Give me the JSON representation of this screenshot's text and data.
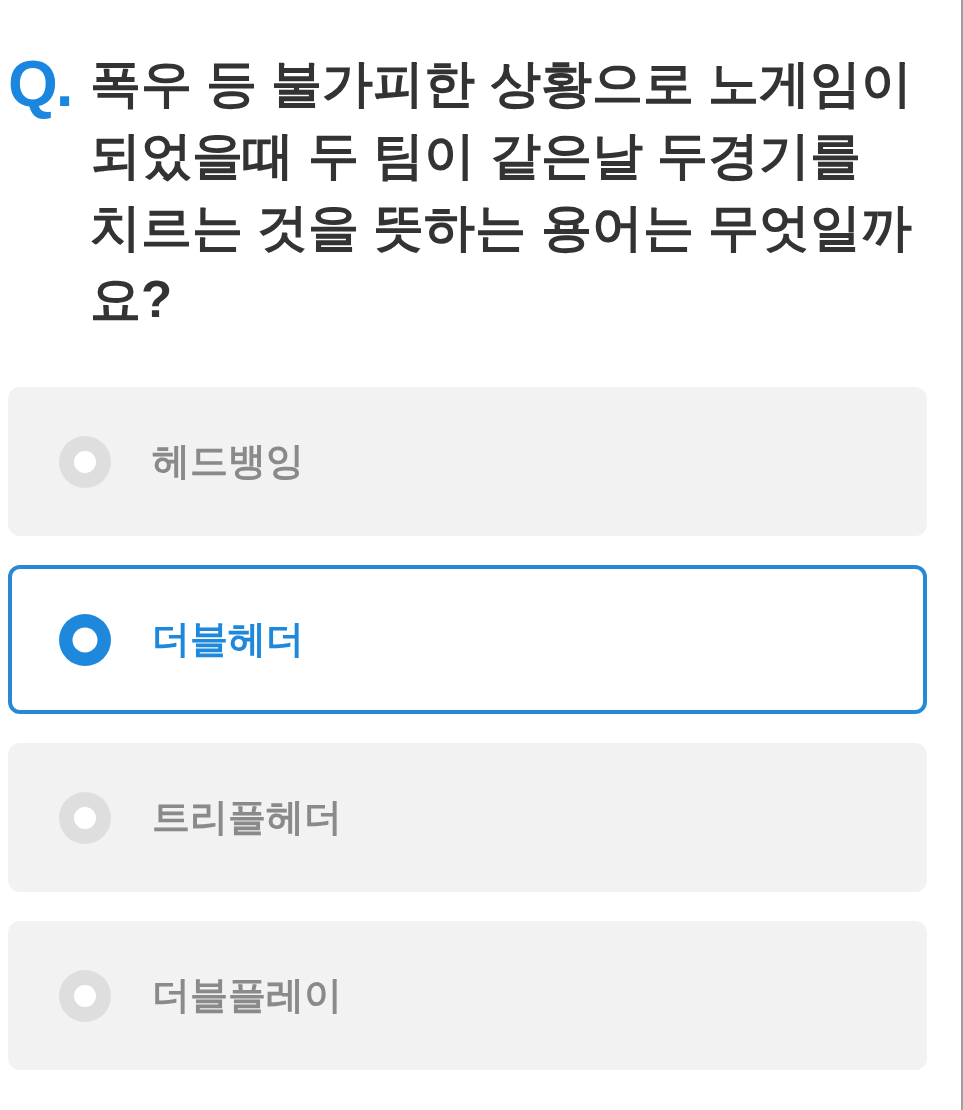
{
  "question": {
    "marker": "Q.",
    "text": "폭우 등 불가피한 상황으로 노게임이 되었을때 두 팀이 같은날 두경기를 치르는 것을 뜻하는 용어는 무엇일까요?"
  },
  "options": [
    {
      "label": "헤드뱅잉",
      "selected": false
    },
    {
      "label": "더블헤더",
      "selected": true
    },
    {
      "label": "트리플헤더",
      "selected": false
    },
    {
      "label": "더블플레이",
      "selected": false
    }
  ]
}
